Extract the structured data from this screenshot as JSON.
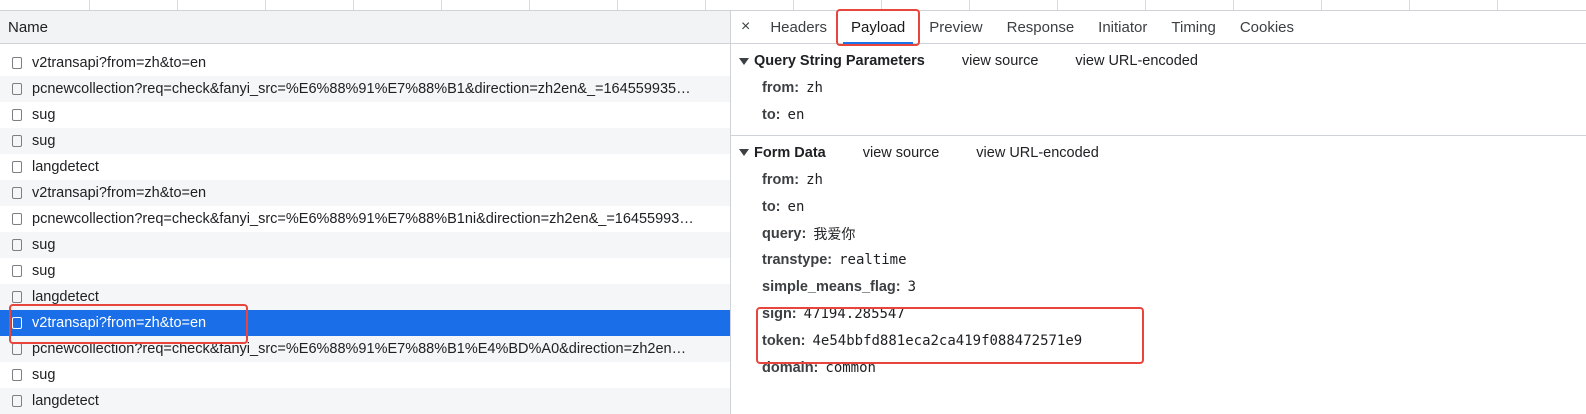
{
  "list": {
    "header": "Name",
    "rows": [
      {
        "name": "v2transapi?from=zh&to=en",
        "selected": false
      },
      {
        "name": "pcnewcollection?req=check&fanyi_src=%E6%88%91%E7%88%B1&direction=zh2en&_=164559935…",
        "selected": false
      },
      {
        "name": "sug",
        "selected": false
      },
      {
        "name": "sug",
        "selected": false
      },
      {
        "name": "langdetect",
        "selected": false
      },
      {
        "name": "v2transapi?from=zh&to=en",
        "selected": false
      },
      {
        "name": "pcnewcollection?req=check&fanyi_src=%E6%88%91%E7%88%B1ni&direction=zh2en&_=16455993…",
        "selected": false
      },
      {
        "name": "sug",
        "selected": false
      },
      {
        "name": "sug",
        "selected": false
      },
      {
        "name": "langdetect",
        "selected": false
      },
      {
        "name": "v2transapi?from=zh&to=en",
        "selected": true
      },
      {
        "name": "pcnewcollection?req=check&fanyi_src=%E6%88%91%E7%88%B1%E4%BD%A0&direction=zh2en…",
        "selected": false
      },
      {
        "name": "sug",
        "selected": false
      },
      {
        "name": "langdetect",
        "selected": false
      }
    ]
  },
  "tabs": {
    "close": "×",
    "items": [
      "Headers",
      "Payload",
      "Preview",
      "Response",
      "Initiator",
      "Timing",
      "Cookies"
    ],
    "active": "Payload"
  },
  "query": {
    "title": "Query String Parameters",
    "view_source": "view source",
    "view_url_encoded": "view URL-encoded",
    "params": [
      {
        "key": "from:",
        "value": "zh"
      },
      {
        "key": "to:",
        "value": "en"
      }
    ]
  },
  "form": {
    "title": "Form Data",
    "view_source": "view source",
    "view_url_encoded": "view URL-encoded",
    "params": [
      {
        "key": "from:",
        "value": "zh"
      },
      {
        "key": "to:",
        "value": "en"
      },
      {
        "key": "query:",
        "value": "我爱你"
      },
      {
        "key": "transtype:",
        "value": "realtime"
      },
      {
        "key": "simple_means_flag:",
        "value": "3"
      },
      {
        "key": "sign:",
        "value": "47194.285547"
      },
      {
        "key": "token:",
        "value": "4e54bbfd881eca2ca419f088472571e9"
      },
      {
        "key": "domain:",
        "value": "common"
      }
    ]
  },
  "colors": {
    "selected_row": "#1a6ee8",
    "annotation_red": "#e8453c",
    "active_tab_underline": "#1a73e8"
  }
}
